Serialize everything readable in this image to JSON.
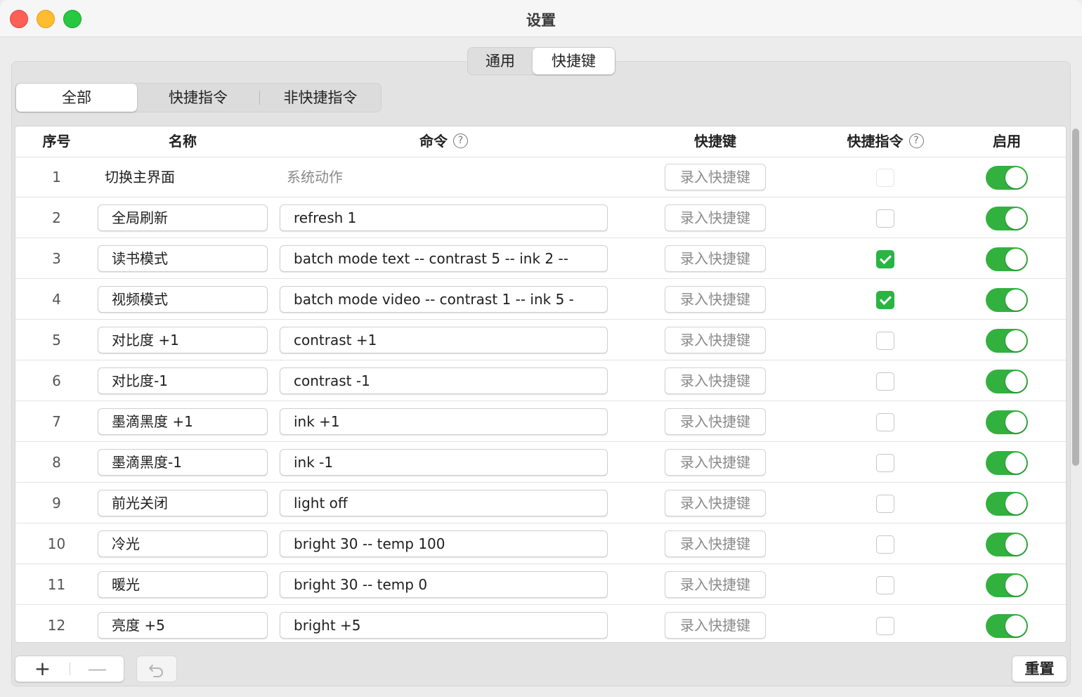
{
  "window": {
    "title": "设置"
  },
  "top_tabs": [
    {
      "label": "通用",
      "selected": false
    },
    {
      "label": "快捷键",
      "selected": true
    }
  ],
  "filter_tabs": [
    {
      "label": "全部",
      "selected": true
    },
    {
      "label": "快捷指令",
      "selected": false
    },
    {
      "label": "非快捷指令",
      "selected": false
    }
  ],
  "table": {
    "headers": {
      "index": "序号",
      "name": "名称",
      "command": "命令",
      "shortcut": "快捷键",
      "quick_command": "快捷指令",
      "enabled": "启用"
    },
    "help_glyph": "?",
    "shortcut_button_label": "录入快捷键",
    "rows": [
      {
        "index": "1",
        "name": "切换主界面",
        "command": "系统动作",
        "editable": false,
        "quick_command": false,
        "enabled": true
      },
      {
        "index": "2",
        "name": "全局刷新",
        "command": "refresh 1",
        "editable": true,
        "quick_command": false,
        "enabled": true
      },
      {
        "index": "3",
        "name": "读书模式",
        "command": "batch mode text -- contrast 5 -- ink 2 --",
        "editable": true,
        "quick_command": true,
        "enabled": true
      },
      {
        "index": "4",
        "name": "视频模式",
        "command": "batch mode video -- contrast 1 -- ink 5 -",
        "editable": true,
        "quick_command": true,
        "enabled": true
      },
      {
        "index": "5",
        "name": "对比度 +1",
        "command": "contrast +1",
        "editable": true,
        "quick_command": false,
        "enabled": true
      },
      {
        "index": "6",
        "name": "对比度-1",
        "command": "contrast -1",
        "editable": true,
        "quick_command": false,
        "enabled": true
      },
      {
        "index": "7",
        "name": "墨滴黑度 +1",
        "command": "ink +1",
        "editable": true,
        "quick_command": false,
        "enabled": true
      },
      {
        "index": "8",
        "name": "墨滴黑度-1",
        "command": "ink -1",
        "editable": true,
        "quick_command": false,
        "enabled": true
      },
      {
        "index": "9",
        "name": "前光关闭",
        "command": "light off",
        "editable": true,
        "quick_command": false,
        "enabled": true
      },
      {
        "index": "10",
        "name": "冷光",
        "command": "bright 30 -- temp 100",
        "editable": true,
        "quick_command": false,
        "enabled": true
      },
      {
        "index": "11",
        "name": "暖光",
        "command": "bright 30 -- temp 0",
        "editable": true,
        "quick_command": false,
        "enabled": true
      },
      {
        "index": "12",
        "name": "亮度 +5",
        "command": "bright +5",
        "editable": true,
        "quick_command": false,
        "enabled": true
      }
    ]
  },
  "footer": {
    "plus_glyph": "+",
    "minus_glyph": "—",
    "reset_label": "重置"
  },
  "colors": {
    "toggle_on": "#32b13f",
    "checkbox_checked": "#29b543"
  }
}
